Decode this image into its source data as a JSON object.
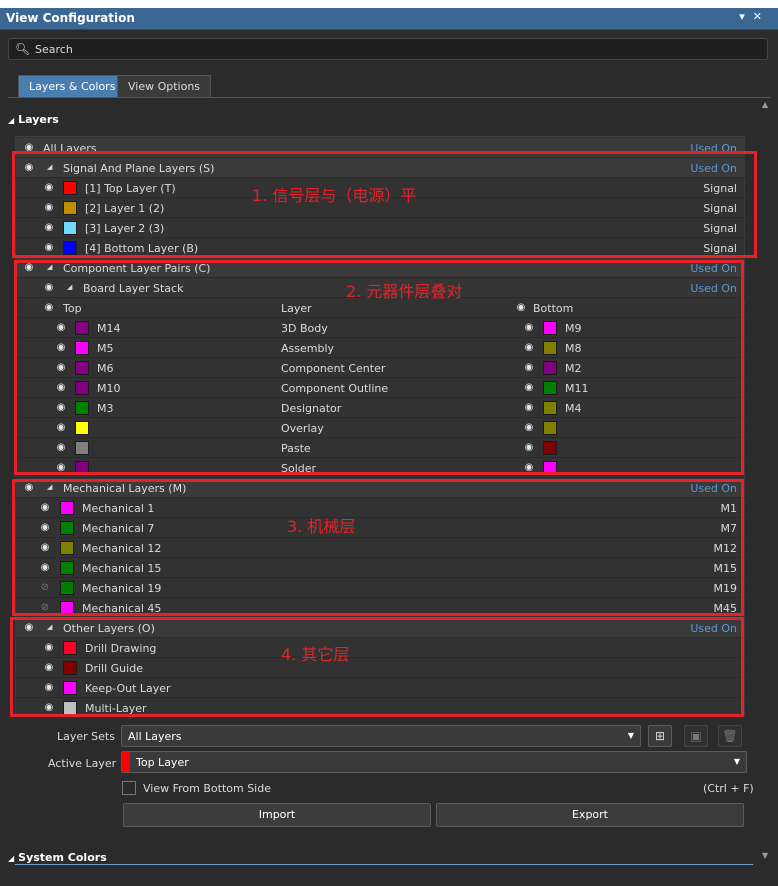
{
  "panel": {
    "title": "View Configuration"
  },
  "search": {
    "placeholder": "Search"
  },
  "tabs": [
    {
      "label": "Layers & Colors"
    },
    {
      "label": "View Options"
    }
  ],
  "sections": {
    "layers": "Layers",
    "system_colors": "System Colors"
  },
  "all_layers": {
    "label": "All Layers",
    "status": "Used On"
  },
  "signal_group": {
    "label": "Signal And Plane Layers (S)",
    "status": "Used On",
    "items": [
      {
        "name": "[1] Top Layer (T)",
        "type": "Signal",
        "color": "#ff0000"
      },
      {
        "name": "[2] Layer 1 (2)",
        "type": "Signal",
        "color": "#bc8e00"
      },
      {
        "name": "[3] Layer 2 (3)",
        "type": "Signal",
        "color": "#70dbfa"
      },
      {
        "name": "[4] Bottom Layer (B)",
        "type": "Signal",
        "color": "#0000ff"
      }
    ]
  },
  "component_group": {
    "label": "Component Layer Pairs (C)",
    "status": "Used On",
    "stack": {
      "label": "Board Layer Stack",
      "status": "Used On"
    },
    "headers": {
      "top": "Top",
      "layer": "Layer",
      "bottom": "Bottom"
    },
    "pairs": [
      {
        "top": "M14",
        "top_color": "#800080",
        "layer": "3D Body",
        "bottom": "M9",
        "bottom_color": "#ff00ff"
      },
      {
        "top": "M5",
        "top_color": "#ff00ff",
        "layer": "Assembly",
        "bottom": "M8",
        "bottom_color": "#808000"
      },
      {
        "top": "M6",
        "top_color": "#800080",
        "layer": "Component Center",
        "bottom": "M2",
        "bottom_color": "#800080"
      },
      {
        "top": "M10",
        "top_color": "#800080",
        "layer": "Component Outline",
        "bottom": "M11",
        "bottom_color": "#008000"
      },
      {
        "top": "M3",
        "top_color": "#008000",
        "layer": "Designator",
        "bottom": "M4",
        "bottom_color": "#808000"
      },
      {
        "top": "",
        "top_color": "#ffff00",
        "layer": "Overlay",
        "bottom": "",
        "bottom_color": "#808000"
      },
      {
        "top": "",
        "top_color": "#808080",
        "layer": "Paste",
        "bottom": "",
        "bottom_color": "#800000"
      },
      {
        "top": "",
        "top_color": "#800080",
        "layer": "Solder",
        "bottom": "",
        "bottom_color": "#ff00ff"
      }
    ]
  },
  "mechanical_group": {
    "label": "Mechanical Layers (M)",
    "status": "Used On",
    "items": [
      {
        "name": "Mechanical 1",
        "code": "M1",
        "color": "#ff00ff",
        "visible": true
      },
      {
        "name": "Mechanical 7",
        "code": "M7",
        "color": "#008000",
        "visible": true
      },
      {
        "name": "Mechanical 12",
        "code": "M12",
        "color": "#808000",
        "visible": true
      },
      {
        "name": "Mechanical 15",
        "code": "M15",
        "color": "#008000",
        "visible": true
      },
      {
        "name": "Mechanical 19",
        "code": "M19",
        "color": "#008000",
        "visible": false
      },
      {
        "name": "Mechanical 45",
        "code": "M45",
        "color": "#ff00ff",
        "visible": false
      }
    ]
  },
  "other_group": {
    "label": "Other Layers (O)",
    "status": "Used On",
    "items": [
      {
        "name": "Drill Drawing",
        "color": "#ff002a"
      },
      {
        "name": "Drill Guide",
        "color": "#800000"
      },
      {
        "name": "Keep-Out Layer",
        "color": "#ff00ff"
      },
      {
        "name": "Multi-Layer",
        "color": "#c0c0c0"
      }
    ]
  },
  "annotations": [
    "1. 信号层与（电源）平",
    "2. 元器件层叠对",
    "3. 机械层",
    "4. 其它层"
  ],
  "controls": {
    "layer_sets_label": "Layer Sets",
    "layer_sets_value": "All Layers",
    "active_layer_label": "Active Layer",
    "active_layer_value": "Top Layer",
    "active_layer_color": "#ff0000",
    "view_from_bottom": "View From Bottom Side",
    "shortcut": "(Ctrl + F)",
    "import": "Import",
    "export": "Export"
  },
  "accent": "#4a7eb0",
  "annotation_color": "#e5222a",
  "used_on_color": "#5b9ad5"
}
